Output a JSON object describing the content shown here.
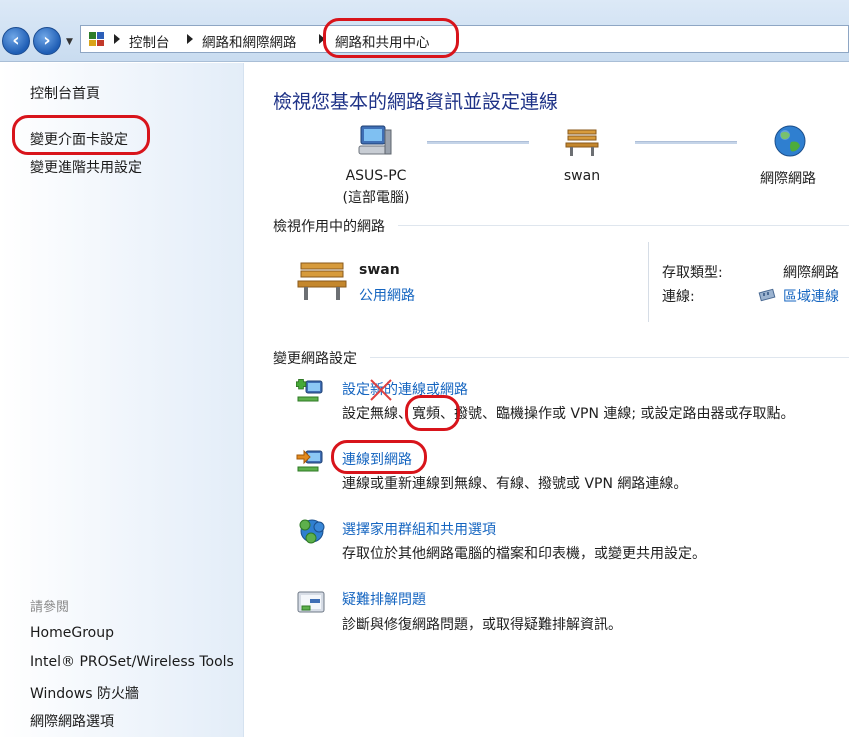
{
  "address_bar": {
    "crumbs": [
      "控制台",
      "網路和網際網路",
      "網路和共用中心"
    ]
  },
  "sidebar": {
    "links": [
      "控制台首頁",
      "變更介面卡設定",
      "變更進階共用設定"
    ],
    "see_also_heading": "請參閱",
    "see_also": [
      "HomeGroup",
      "Intel® PROSet/Wireless Tools",
      "Windows 防火牆",
      "網際網路選項"
    ]
  },
  "main": {
    "title": "檢視您基本的網路資訊並設定連線",
    "map": {
      "computer_name": "ASUS-PC",
      "computer_sub": "(這部電腦)",
      "network_name": "swan",
      "internet_label": "網際網路"
    },
    "active_networks": {
      "heading": "檢視作用中的網路",
      "network_name": "swan",
      "network_type": "公用網路",
      "access_type_label": "存取類型:",
      "access_type_value": "網際網路",
      "connections_label": "連線:",
      "connections_value": "區域連線"
    },
    "change_settings": {
      "heading": "變更網路設定",
      "tasks": [
        {
          "title": "設定新的連線或網路",
          "desc_a": "設定無線、",
          "desc_highlight": "寬頻",
          "desc_b": "、撥號、臨機操作或 VPN 連線; 或設定路由器或存取點。"
        },
        {
          "title": "連線到網路",
          "desc": "連線或重新連線到無線、有線、撥號或 VPN 網路連線。"
        },
        {
          "title": "選擇家用群組和共用選項",
          "desc": "存取位於其他網路電腦的檔案和印表機，或變更共用設定。"
        },
        {
          "title": "疑難排解問題",
          "desc": "診斷與修復網路問題，或取得疑難排解資訊。"
        }
      ]
    }
  },
  "colors": {
    "link": "#1565c0",
    "title": "#1e3287",
    "annotation_circle": "#d8141b"
  }
}
